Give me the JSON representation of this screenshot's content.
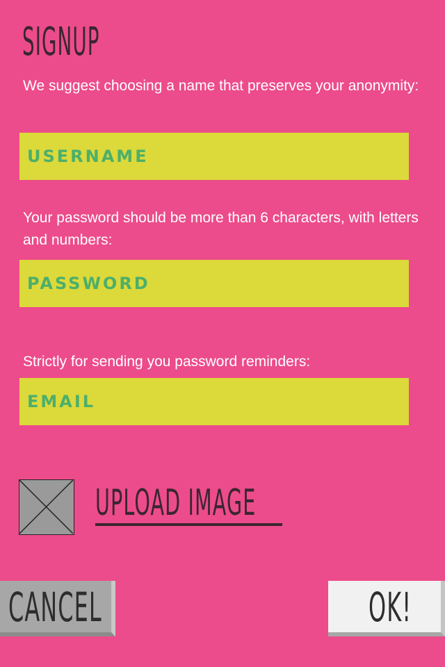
{
  "page": {
    "title": "SIGNUP",
    "colors": {
      "background": "#ec4c8b",
      "field": "#dcd93a",
      "field_text": "#4caf6a",
      "title_text": "#3a2630"
    }
  },
  "username": {
    "hint": "We suggest choosing a name that preserves your anonymity:",
    "placeholder": "USERNAME"
  },
  "password": {
    "hint": "Your password should be more than 6 characters, with letters and numbers:",
    "placeholder": "PASSWORD"
  },
  "email": {
    "hint": "Strictly for sending you password reminders:",
    "placeholder": "EMAIL"
  },
  "upload": {
    "label": "UPLOAD IMAGE",
    "icon": "image-placeholder-icon"
  },
  "actions": {
    "cancel_label": "CANCEL",
    "ok_label": "OK!"
  }
}
